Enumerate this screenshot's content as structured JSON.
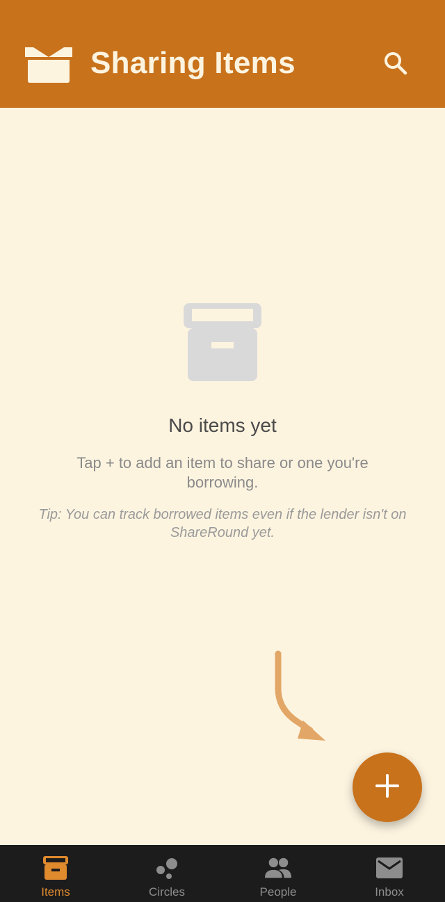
{
  "appbar": {
    "title": "Sharing Items",
    "logo_icon": "open-box-icon",
    "search_icon": "search-icon",
    "background": "#c8721c"
  },
  "empty_state": {
    "icon": "archive-box-icon",
    "title": "No items yet",
    "description": "Tap + to add an item to share or one you're borrowing.",
    "tip": "Tip: You can track borrowed items even if the lender isn't on ShareRound yet."
  },
  "fab": {
    "icon": "plus-icon",
    "color": "#c8721c"
  },
  "bottom_nav": {
    "items": [
      {
        "label": "Items",
        "icon": "archive-box-icon",
        "active": true
      },
      {
        "label": "Circles",
        "icon": "circles-icon",
        "active": false
      },
      {
        "label": "People",
        "icon": "people-icon",
        "active": false
      },
      {
        "label": "Inbox",
        "icon": "mail-icon",
        "active": false
      }
    ],
    "active_color": "#e08a2e",
    "inactive_color": "#8d8d8d"
  }
}
